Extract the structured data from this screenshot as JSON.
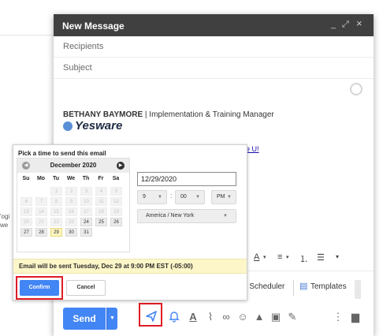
{
  "background": {
    "fragment_1": "'ogi",
    "fragment_2": "we"
  },
  "compose": {
    "title": "New Message",
    "controls": {
      "minimize": "_",
      "expand": "⤢",
      "close": "×"
    },
    "recipients_placeholder": "Recipients",
    "subject_placeholder": "Subject",
    "signature": {
      "name": "BETHANY BAYMORE",
      "separator": " | ",
      "role": "Implementation & Training Manager",
      "logo_text": "Yesware"
    },
    "link_fragment": "e U!",
    "link_fragment_2": "n"
  },
  "format_bar": {
    "text_color": "A",
    "align": "≡",
    "numbered_list": "⒈",
    "bullet_list": "☰",
    "more": "▾"
  },
  "extension_bar": {
    "scheduler_label": "g Scheduler",
    "templates_label": "Templates"
  },
  "bottom_bar": {
    "send_label": "Send",
    "send_more": "▼",
    "icons": [
      "schedule-send-icon",
      "reminder-bell-icon",
      "format-text-icon",
      "attach-icon",
      "link-icon",
      "emoji-icon",
      "drive-icon",
      "photo-icon",
      "signature-icon",
      "more-options-icon",
      "trash-icon"
    ]
  },
  "scheduler": {
    "title": "Pick a time to send this email",
    "calendar": {
      "month": "December 2020",
      "weekdays": [
        "Su",
        "Mo",
        "Tu",
        "We",
        "Th",
        "Fr",
        "Sa"
      ],
      "weeks": [
        [
          "",
          "",
          "1",
          "2",
          "3",
          "4",
          "5"
        ],
        [
          "6",
          "7",
          "8",
          "9",
          "10",
          "11",
          "12"
        ],
        [
          "13",
          "14",
          "15",
          "16",
          "17",
          "18",
          "19"
        ],
        [
          "20",
          "21",
          "22",
          "23",
          "24",
          "25",
          "26"
        ],
        [
          "27",
          "28",
          "29",
          "30",
          "31",
          "",
          ""
        ]
      ],
      "selected_day": "29",
      "available_days": [
        "24",
        "25",
        "26",
        "27",
        "28",
        "29",
        "30",
        "31"
      ]
    },
    "date_value": "12/29/2020",
    "hour": "9",
    "minute": "00",
    "ampm": "PM",
    "timezone": "America / New York",
    "notice": "Email will be sent Tuesday, Dec 29 at 9:00 PM EST (-05:00)",
    "confirm_label": "Confirm",
    "cancel_label": "Cancel"
  },
  "colors": {
    "header_bg": "#404040",
    "send_blue": "#4285f4",
    "highlight_red": "#e01b24",
    "notice_bg": "#fdf6c8"
  }
}
